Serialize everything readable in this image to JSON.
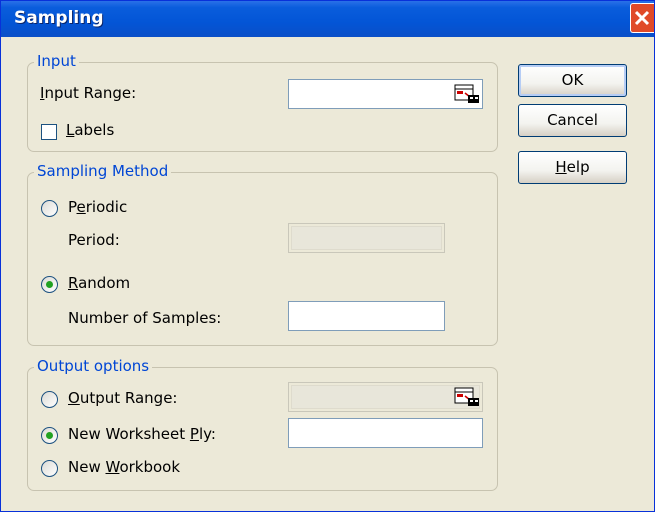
{
  "dialog": {
    "title": "Sampling"
  },
  "input_group": {
    "legend": "Input",
    "input_range_label": "Input Range:",
    "input_range_value": "",
    "labels_checkbox": {
      "label": "Labels",
      "checked": false
    }
  },
  "method_group": {
    "legend": "Sampling Method",
    "periodic": {
      "label": "Periodic",
      "selected": false
    },
    "period_label": "Period:",
    "period_value": "",
    "random": {
      "label": "Random",
      "selected": true
    },
    "num_samples_label": "Number of Samples:",
    "num_samples_value": ""
  },
  "output_group": {
    "legend": "Output options",
    "output_range": {
      "label": "Output Range:",
      "selected": false,
      "value": ""
    },
    "new_worksheet": {
      "label": "New Worksheet Ply:",
      "selected": true,
      "value": ""
    },
    "new_workbook": {
      "label": "New Workbook",
      "selected": false
    }
  },
  "buttons": {
    "ok": "OK",
    "cancel": "Cancel",
    "help": "Help"
  },
  "icons": {
    "close": "close-icon",
    "refedit": "range-select-icon"
  },
  "colors": {
    "titlebar": "#0355d6",
    "legend_text": "#0046d5",
    "dialog_bg": "#ece9d8",
    "close": "#e04a29"
  }
}
